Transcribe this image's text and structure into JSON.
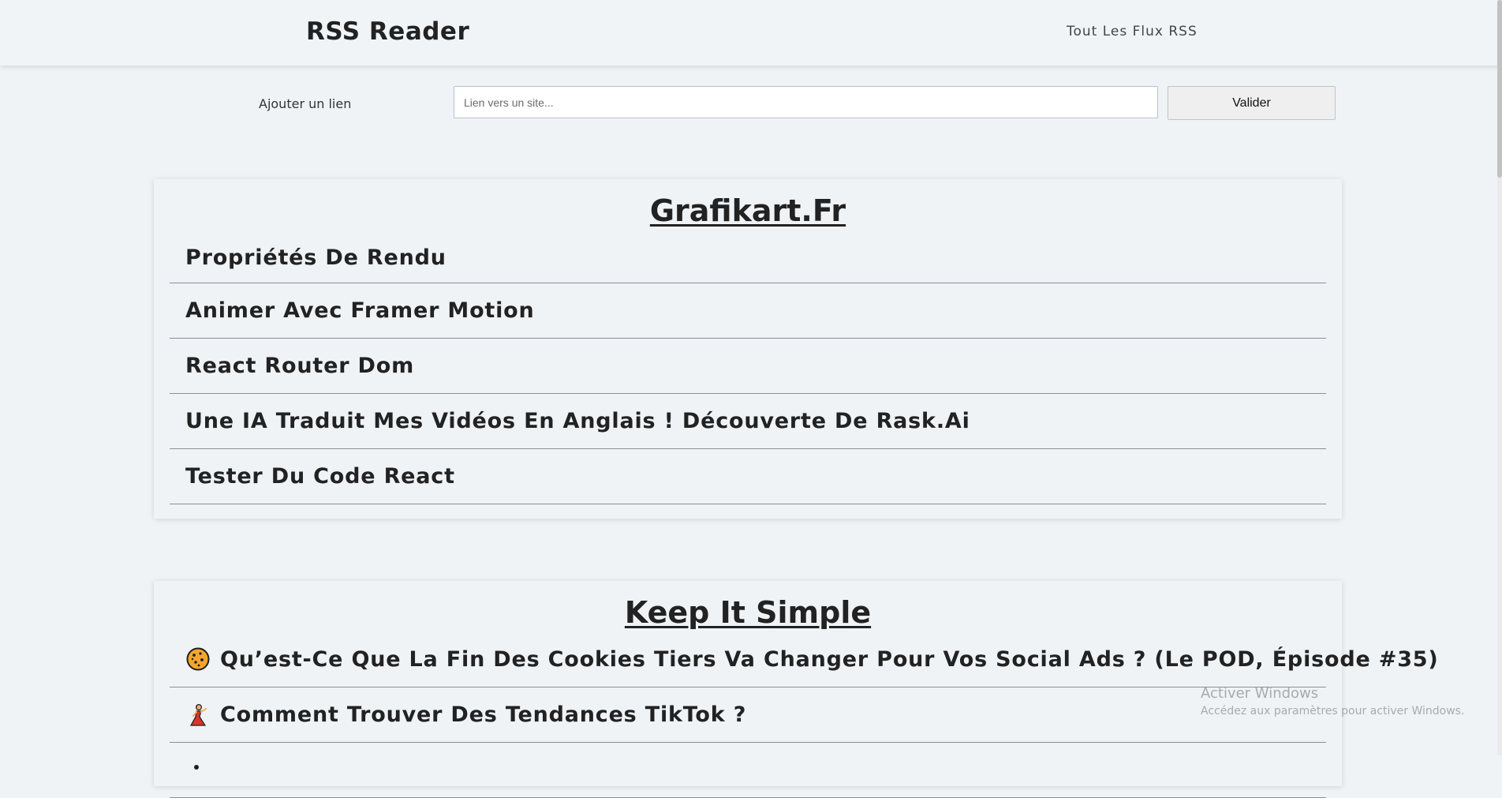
{
  "navbar": {
    "brand": "RSS Reader",
    "all_feeds_link": "Tout Les Flux RSS"
  },
  "add_link": {
    "label": "Ajouter un lien",
    "placeholder": "Lien vers un site...",
    "value": "",
    "submit_label": "Valider"
  },
  "feeds": [
    {
      "title": "Grafikart.Fr",
      "items": [
        {
          "title": "Propriétés De Rendu"
        },
        {
          "title": "Animer Avec Framer Motion"
        },
        {
          "title": "React Router Dom"
        },
        {
          "title": "Une IA Traduit Mes Vidéos En Anglais ! Découverte De Rask.Ai"
        },
        {
          "title": "Tester Du Code React"
        }
      ]
    },
    {
      "title": "Keep It Simple",
      "items": [
        {
          "title": "Qu’est-Ce Que La Fin Des Cookies Tiers Va Changer Pour Vos Social Ads ? (Le POD, Épisode #35)",
          "icon": "cookie-icon"
        },
        {
          "title": "Comment Trouver Des Tendances TikTok ?",
          "icon": "dancer-icon"
        },
        {
          "title": "",
          "icon": "partial-icon"
        }
      ]
    }
  ],
  "watermark": {
    "title": "Activer Windows",
    "subtitle": "Accédez aux paramètres pour activer Windows."
  }
}
